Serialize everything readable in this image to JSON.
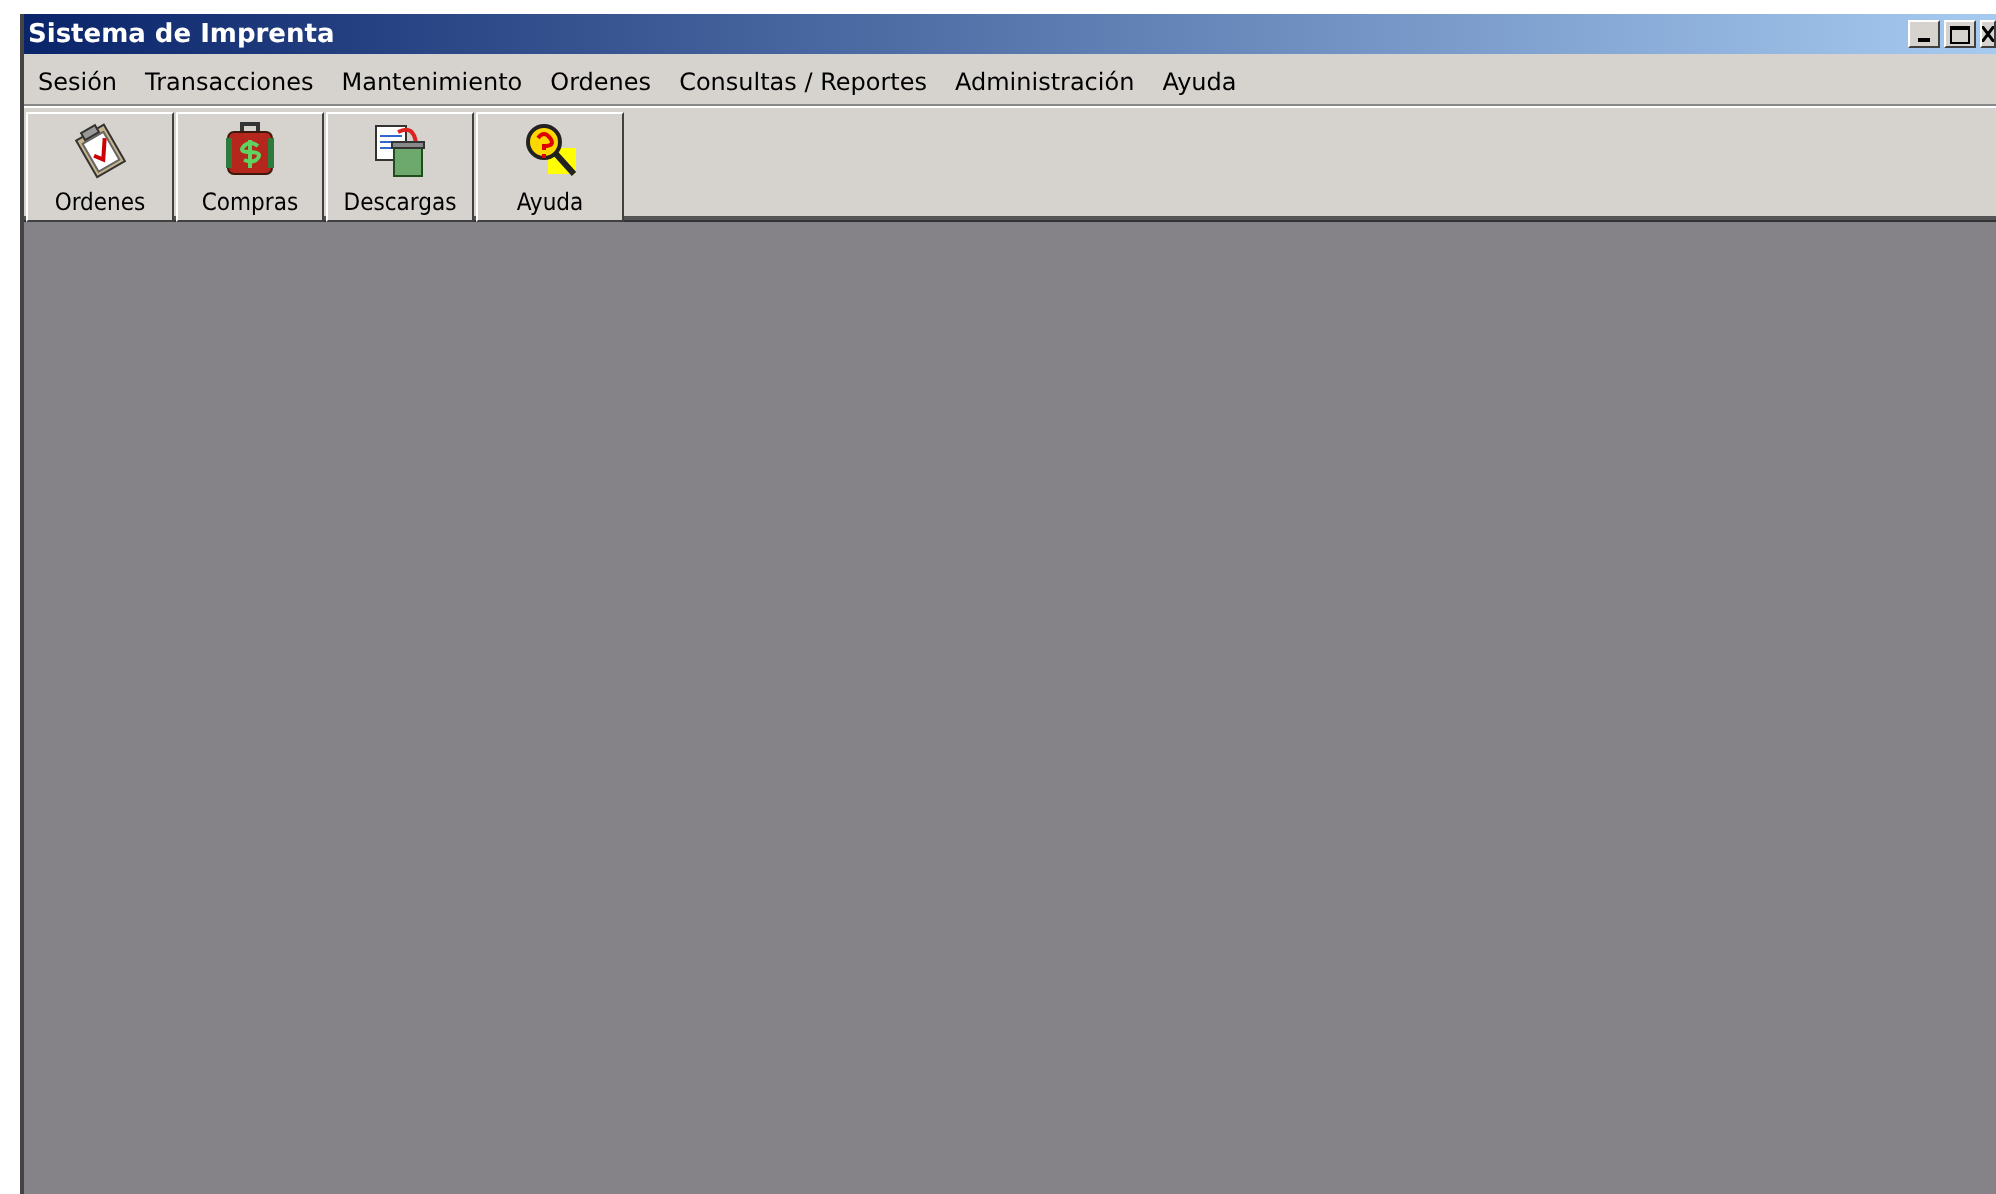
{
  "window": {
    "title": "Sistema de Imprenta"
  },
  "menu": [
    "Sesión",
    "Transacciones",
    "Mantenimiento",
    "Ordenes",
    "Consultas / Reportes",
    "Administración",
    "Ayuda"
  ],
  "toolbar": [
    {
      "kind": "clipboard",
      "label": "Ordenes"
    },
    {
      "kind": "money",
      "label": "Compras"
    },
    {
      "kind": "download",
      "label": "Descargas"
    },
    {
      "kind": "help",
      "label": "Ayuda"
    }
  ]
}
